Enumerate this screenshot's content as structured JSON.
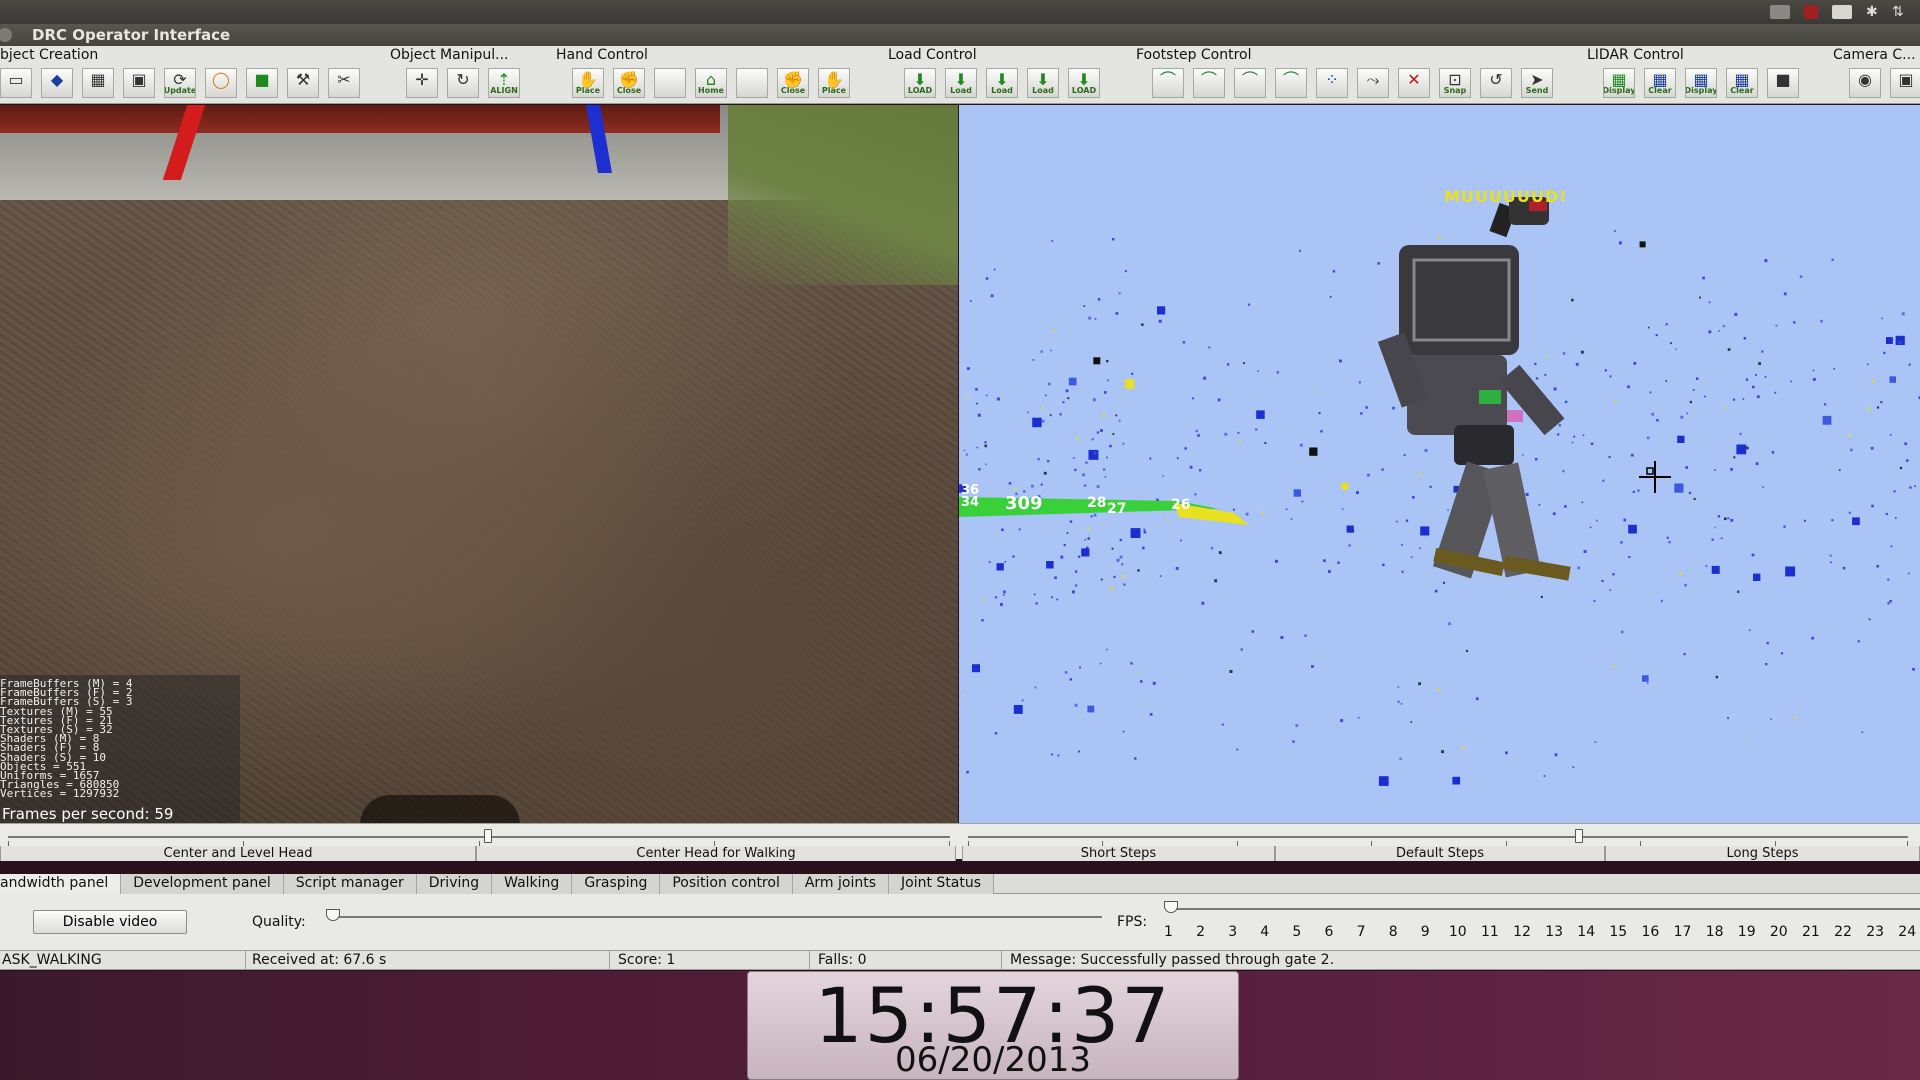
{
  "window": {
    "title": "DRC Operator Interface"
  },
  "toolbar": {
    "groups": [
      {
        "label": "bject Creation",
        "buttons": [
          {
            "icon": "select-icon",
            "text": ""
          },
          {
            "icon": "cube-icon",
            "text": ""
          },
          {
            "icon": "grid-icon",
            "text": ""
          },
          {
            "icon": "vehicle-icon",
            "text": ""
          },
          {
            "icon": "update-icon",
            "text": "Update"
          },
          {
            "icon": "ring-icon",
            "text": ""
          },
          {
            "icon": "box-icon",
            "text": ""
          },
          {
            "icon": "tool-icon",
            "text": ""
          },
          {
            "icon": "wrench-icon",
            "text": ""
          }
        ]
      },
      {
        "label": "Object Manipul...",
        "buttons": [
          {
            "icon": "move-icon",
            "text": ""
          },
          {
            "icon": "rotate-icon",
            "text": ""
          },
          {
            "icon": "align-icon",
            "text": "ALIGN"
          }
        ]
      },
      {
        "label": "Hand Control",
        "buttons": [
          {
            "icon": "hand-place-icon",
            "text": "Place"
          },
          {
            "icon": "hand-close-icon",
            "text": "Close"
          },
          {
            "icon": "hand-blank-icon",
            "text": ""
          },
          {
            "icon": "hand-home-icon",
            "text": "Home"
          },
          {
            "icon": "hand-blank2-icon",
            "text": ""
          },
          {
            "icon": "hand-close2-icon",
            "text": "Close"
          },
          {
            "icon": "hand-place2-icon",
            "text": "Place"
          }
        ]
      },
      {
        "label": "Load Control",
        "buttons": [
          {
            "icon": "load-icon",
            "text": "LOAD"
          },
          {
            "icon": "load-a-icon",
            "text": "Load"
          },
          {
            "icon": "load-b-icon",
            "text": "Load"
          },
          {
            "icon": "load-c-icon",
            "text": "Load"
          },
          {
            "icon": "load-d-icon",
            "text": "LOAD"
          }
        ]
      },
      {
        "label": "Footstep Control",
        "buttons": [
          {
            "icon": "footstep-left-icon",
            "text": ""
          },
          {
            "icon": "footstep-right-icon",
            "text": ""
          },
          {
            "icon": "footstep-both-icon",
            "text": ""
          },
          {
            "icon": "footstep-pair-icon",
            "text": ""
          },
          {
            "icon": "footstep-dots-icon",
            "text": ""
          },
          {
            "icon": "footstep-path-icon",
            "text": ""
          },
          {
            "icon": "footstep-cancel-icon",
            "text": ""
          },
          {
            "icon": "snap-icon",
            "text": "Snap"
          },
          {
            "icon": "footstep-loop-icon",
            "text": ""
          },
          {
            "icon": "footstep-send-icon",
            "text": "Send"
          }
        ]
      },
      {
        "label": "LIDAR Control",
        "buttons": [
          {
            "icon": "lidar-display-icon",
            "text": "Display"
          },
          {
            "icon": "lidar-clear-icon",
            "text": "Clear"
          },
          {
            "icon": "lidar-display2-icon",
            "text": "Display"
          },
          {
            "icon": "lidar-clear2-icon",
            "text": "Clear"
          },
          {
            "icon": "lidar-black-icon",
            "text": ""
          }
        ]
      },
      {
        "label": "Camera C...",
        "buttons": [
          {
            "icon": "eye-icon",
            "text": ""
          },
          {
            "icon": "camera-icon",
            "text": ""
          }
        ]
      }
    ]
  },
  "camera": {
    "stats": [
      "FrameBuffers (M) = 4",
      "FrameBuffers (F) = 2",
      "FrameBuffers (S) = 3",
      "Textures (M) = 55",
      "Textures (F) = 21",
      "Textures (S) = 32",
      "Shaders (M) = 8",
      "Shaders (F) = 8",
      "Shaders (S) = 10",
      "Objects = 551",
      "Uniforms = 1657",
      "Triangles = 680850",
      "Vertices = 1297932"
    ],
    "fps_text": "Frames per second: 59"
  },
  "world": {
    "robot_label": "MUUUUUUD!",
    "path_labels": [
      "36",
      "34",
      "309",
      "28",
      "27",
      "26"
    ]
  },
  "sliders": {
    "head_presets": [
      "Center and Level Head",
      "Center Head for Walking"
    ],
    "step_presets": [
      "Short Steps",
      "Default Steps",
      "Long Steps"
    ],
    "head_value_fraction": 0.51,
    "step_value_fraction": 0.65
  },
  "tabs": [
    "andwidth panel",
    "Development panel",
    "Script manager",
    "Driving",
    "Walking",
    "Grasping",
    "Position control",
    "Arm joints",
    "Joint Status"
  ],
  "active_tab": 0,
  "panel": {
    "disable_video_label": "Disable video",
    "quality_label": "Quality:",
    "fps_label": "FPS:",
    "fps_values": [
      "1",
      "2",
      "3",
      "4",
      "5",
      "6",
      "7",
      "8",
      "9",
      "10",
      "11",
      "12",
      "13",
      "14",
      "15",
      "16",
      "17",
      "18",
      "19",
      "20",
      "21",
      "22",
      "23",
      "24"
    ],
    "quality_value_fraction": 0.0,
    "fps_value_fraction": 0.0
  },
  "status": {
    "task": "ASK_WALKING",
    "received": "Received at:  67.6 s",
    "score": "Score:  1",
    "falls": "Falls:  0",
    "message": "Message:  Successfully passed through gate 2."
  },
  "clock": {
    "time": "15:57:37",
    "date": "06/20/2013"
  },
  "colors": {
    "sky": "#abc4f6",
    "path_green": "#3ad03a",
    "path_yellow": "#e8e020",
    "robot_label": "#e8e020"
  }
}
